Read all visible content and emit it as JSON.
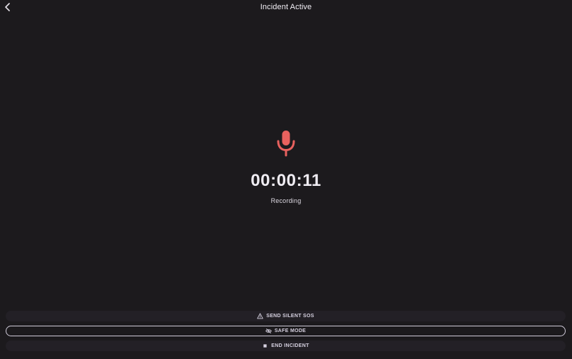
{
  "header": {
    "title": "Incident Active",
    "back_icon": "chevron-left-icon"
  },
  "recorder": {
    "icon": "microphone-icon",
    "icon_color": "#e8615e",
    "elapsed": "00:00:11",
    "status": "Recording"
  },
  "actions": {
    "sos_label": "SEND SILENT SOS",
    "sos_icon": "warning-triangle-icon",
    "safe_label": "SAFE MODE",
    "safe_icon": "eye-off-icon",
    "end_label": "END INCIDENT",
    "end_icon": "stop-square-icon"
  },
  "colors": {
    "background": "#1c1a1d",
    "accent": "#e8615e",
    "button_bg": "#232026",
    "button_text": "#d6d1e0"
  }
}
